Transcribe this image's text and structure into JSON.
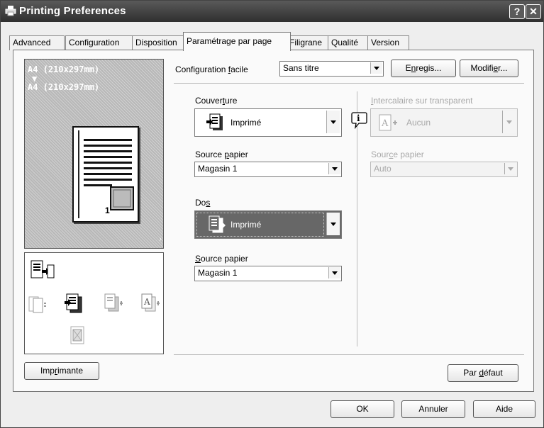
{
  "window": {
    "title": "Printing Preferences",
    "help_label": "?",
    "close_label": "✕"
  },
  "tabs": [
    {
      "label": "Advanced"
    },
    {
      "label": "Configuration"
    },
    {
      "label": "Disposition"
    },
    {
      "label": "Paramétrage par page"
    },
    {
      "label": "Filigrane"
    },
    {
      "label": "Qualité"
    },
    {
      "label": "Version"
    }
  ],
  "active_tab": "Paramétrage par page",
  "preview": {
    "line1": "A4 (210x297mm)",
    "arrow": "▼",
    "line2": "A4 (210x297mm)",
    "page_number": "1"
  },
  "quick_setup": {
    "label_pre": "Configuration ",
    "label_key": "f",
    "label_post": "acile",
    "value": "Sans titre",
    "save_pre": "E",
    "save_key": "n",
    "save_post": "regis...",
    "modify_pre": "Modifi",
    "modify_key": "e",
    "modify_post": "r..."
  },
  "cover": {
    "label_pre": "Couver",
    "label_key": "t",
    "label_post": "ure",
    "value": "Imprimé",
    "source_pre": "Source ",
    "source_key": "p",
    "source_post": "apier",
    "source_value": "Magasin 1"
  },
  "back": {
    "label_pre": "Do",
    "label_key": "s",
    "label_post": "",
    "value": "Imprimé",
    "source_pre": "",
    "source_key": "S",
    "source_post": "ource papier",
    "source_value": "Magasin 1"
  },
  "interleave": {
    "label_pre": "",
    "label_key": "I",
    "label_post": "ntercalaire sur transparent",
    "value": "Aucun",
    "source_pre": "Sour",
    "source_key": "c",
    "source_post": "e papier",
    "source_value": "Auto"
  },
  "buttons": {
    "printer_pre": "Imp",
    "printer_key": "r",
    "printer_post": "imante",
    "default_pre": "Par ",
    "default_key": "d",
    "default_post": "éfaut",
    "ok": "OK",
    "cancel": "Annuler",
    "help": "Aide"
  },
  "icons": [
    "printer-icon",
    "blank-sheet-icon",
    "printed-sheet-icon",
    "sheet-insert-icon",
    "transparency-icon",
    "stamp-icon",
    "info-icon"
  ]
}
